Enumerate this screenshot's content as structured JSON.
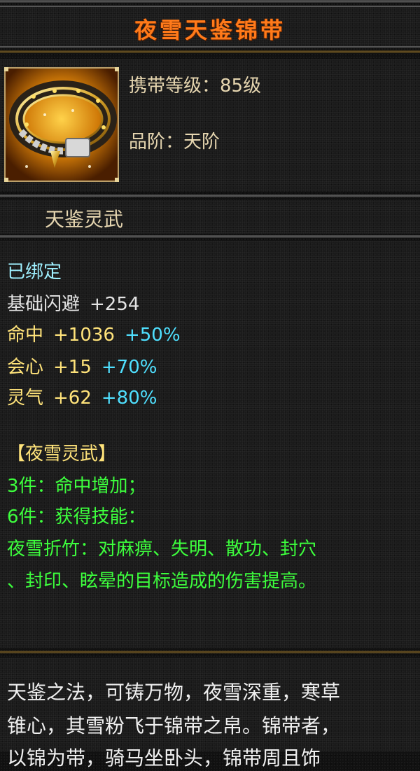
{
  "title": "夜雪天鉴锦带",
  "item": {
    "icon": "belt-icon",
    "level_label": "携带等级：85级",
    "grade_label": "品阶：天阶"
  },
  "set_name": "天鉴灵武",
  "attributes": {
    "bound": "已绑定",
    "base_dodge": {
      "label": "基础闪避",
      "value": "+254"
    },
    "hit": {
      "label": "命中",
      "value": "+1036",
      "bonus": "+50%"
    },
    "crit": {
      "label": "会心",
      "value": "+15",
      "bonus": "+70%"
    },
    "spirit": {
      "label": "灵气",
      "value": "+62",
      "bonus": "+80%"
    }
  },
  "set_bonus": {
    "title": "【夜雪灵武】",
    "piece3": "3件：命中增加；",
    "piece6": "6件：获得技能：",
    "skill_line1": "夜雪折竹：对麻痹、失明、散功、封穴",
    "skill_line2": "、封印、眩晕的目标造成的伤害提高。"
  },
  "description": {
    "line1": "天鉴之法，可铸万物，夜雪深重，寒草",
    "line2": "锥心，其雪粉飞于锦带之帛。锦带者，",
    "line3": "以锦为带，骑马坐卧头，锦带周且饰"
  },
  "colors": {
    "title": "#ff7a1a",
    "bonus": "#4fe0ff",
    "stat": "#ffe37a",
    "set": "#3dff3d"
  }
}
